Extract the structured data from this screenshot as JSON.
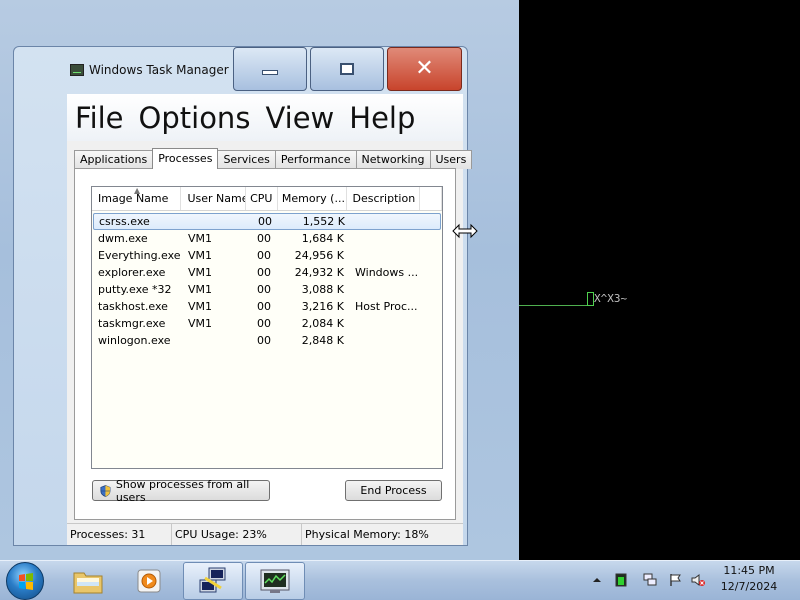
{
  "window": {
    "title": "Windows Task Manager",
    "controls": {
      "minimize": "minimize",
      "maximize": "maximize",
      "close": "close"
    }
  },
  "menu": [
    "File",
    "Options",
    "View",
    "Help"
  ],
  "tabs": [
    {
      "label": "Applications",
      "active": false
    },
    {
      "label": "Processes",
      "active": true
    },
    {
      "label": "Services",
      "active": false
    },
    {
      "label": "Performance",
      "active": false
    },
    {
      "label": "Networking",
      "active": false
    },
    {
      "label": "Users",
      "active": false
    }
  ],
  "process_table": {
    "columns": [
      "Image Name",
      "User Name",
      "CPU",
      "Memory (...",
      "Description"
    ],
    "rows": [
      {
        "image": "csrss.exe",
        "user": "",
        "cpu": "00",
        "memory": "1,552 K",
        "description": "",
        "selected": true
      },
      {
        "image": "dwm.exe",
        "user": "VM1",
        "cpu": "00",
        "memory": "1,684 K",
        "description": ""
      },
      {
        "image": "Everything.exe",
        "user": "VM1",
        "cpu": "00",
        "memory": "24,956 K",
        "description": ""
      },
      {
        "image": "explorer.exe",
        "user": "VM1",
        "cpu": "00",
        "memory": "24,932 K",
        "description": "Windows ..."
      },
      {
        "image": "putty.exe *32",
        "user": "VM1",
        "cpu": "00",
        "memory": "3,088 K",
        "description": ""
      },
      {
        "image": "taskhost.exe",
        "user": "VM1",
        "cpu": "00",
        "memory": "3,216 K",
        "description": "Host Proc..."
      },
      {
        "image": "taskmgr.exe",
        "user": "VM1",
        "cpu": "00",
        "memory": "2,084 K",
        "description": ""
      },
      {
        "image": "winlogon.exe",
        "user": "",
        "cpu": "00",
        "memory": "2,848 K",
        "description": ""
      }
    ]
  },
  "buttons": {
    "show_all": "Show processes from all users",
    "end_process": "End Process"
  },
  "status": {
    "processes": "Processes: 31",
    "cpu": "CPU Usage: 23%",
    "memory": "Physical Memory: 18%"
  },
  "terminal": {
    "text": "X^X3~"
  },
  "taskbar": {
    "time": "11:45 PM",
    "date": "12/7/2024",
    "items": [
      "explorer-folder",
      "media-player",
      "putty",
      "task-manager"
    ]
  },
  "colors": {
    "close_button": "#c8442c",
    "terminal_green": "#4fd04f",
    "selection": "#dcebfc"
  }
}
